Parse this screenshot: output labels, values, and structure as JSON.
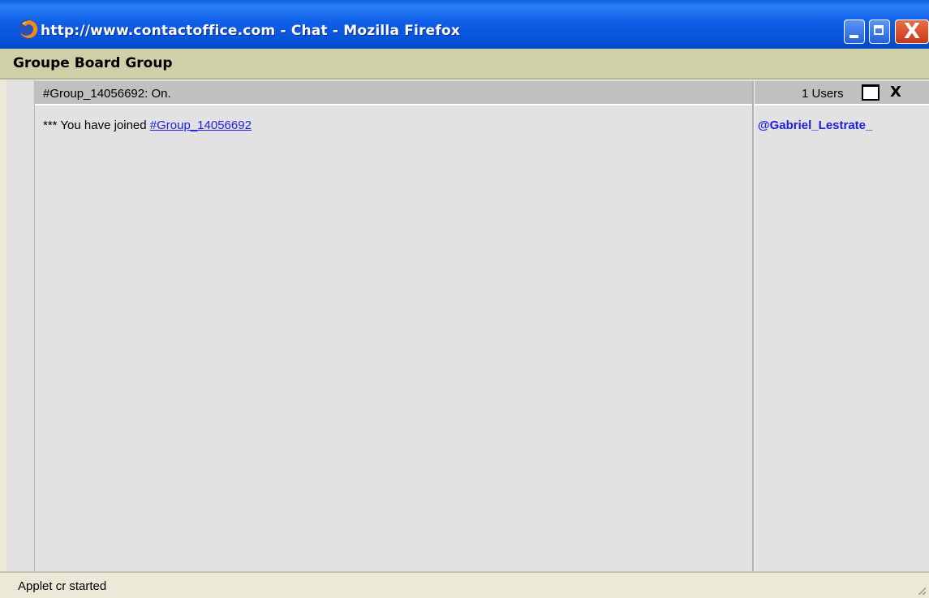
{
  "window": {
    "title": "http://www.contactoffice.com - Chat - Mozilla Firefox",
    "close_glyph": "X",
    "icons": [
      "firefox-icon",
      "minimize-icon",
      "maximize-icon",
      "close-icon"
    ]
  },
  "group": {
    "title": "Groupe Board Group"
  },
  "channel": {
    "status": "#Group_14056692: On.",
    "message_prefix": "*** You have joined ",
    "message_link": "#Group_14056692"
  },
  "users": {
    "count_label": "1 Users",
    "close_label": "X",
    "list": [
      "@Gabriel_Lestrate_"
    ]
  },
  "status_bar": {
    "text": "Applet cr started"
  },
  "colors": {
    "titlebar": "#0754d8",
    "group_header": "#d0d0a8",
    "panel_bg": "#e2e2e2",
    "bar_bg": "#c0c0c0",
    "link": "#2020e8",
    "user": "#1e1ee0"
  }
}
